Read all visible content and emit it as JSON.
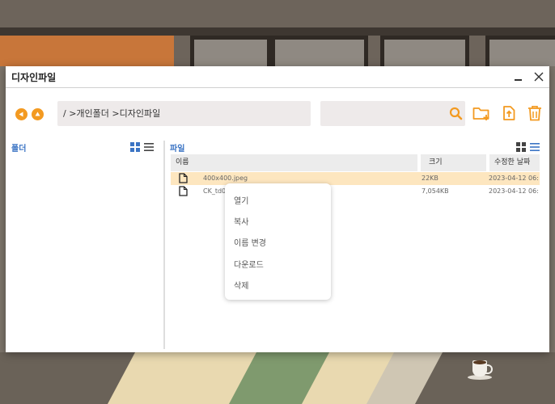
{
  "window": {
    "title": "디자인파일"
  },
  "toolbar": {
    "path": "/ >개인폴더 >디자인파일",
    "search_value": ""
  },
  "panes": {
    "folder_label": "폴더",
    "file_label": "파일"
  },
  "table": {
    "columns": [
      "이름",
      "크기",
      "수정한 날짜"
    ],
    "rows": [
      {
        "name": "400x400.jpeg",
        "size": "22KB",
        "date": "2023-04-12 06:···",
        "selected": true
      },
      {
        "name": "CK_td0",
        "size": "7,054KB",
        "date": "2023-04-12 06:···",
        "selected": false
      }
    ]
  },
  "context_menu": {
    "items": [
      "열기",
      "복사",
      "이름 변경",
      "다운로드",
      "삭제"
    ]
  },
  "colors": {
    "accent": "#f39a21",
    "link_blue": "#3b74c4",
    "selected_row": "#fde6bf"
  },
  "icons": [
    "back-icon",
    "up-icon",
    "search-icon",
    "new-folder-icon",
    "upload-icon",
    "trash-icon",
    "grid-view-icon",
    "list-view-icon",
    "file-icon",
    "minimize-icon",
    "close-icon"
  ]
}
